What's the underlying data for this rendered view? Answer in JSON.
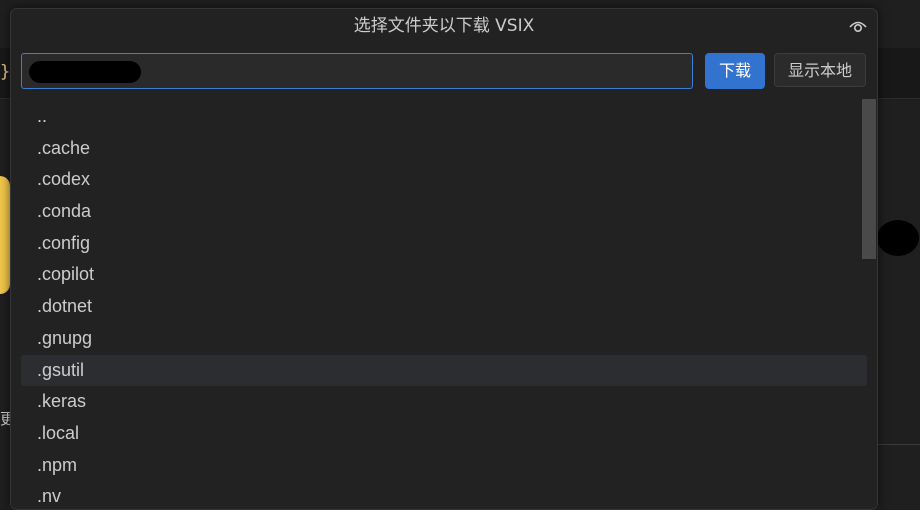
{
  "background": {
    "brace_glyph": "}",
    "bracket_glyph": "[",
    "partial_char": "更"
  },
  "dialog": {
    "title": "选择文件夹以下载 VSIX",
    "eye_icon": "eye-icon",
    "path_input": {
      "value": "",
      "placeholder": ""
    },
    "download_label": "下载",
    "show_local_label": "显示本地",
    "accent_color": "#3273cf",
    "folders": [
      "..",
      ".cache",
      ".codex",
      ".conda",
      ".config",
      ".copilot",
      ".dotnet",
      ".gnupg",
      ".gsutil",
      ".keras",
      ".local",
      ".npm",
      ".nv"
    ],
    "selected_folder": ".gsutil"
  }
}
